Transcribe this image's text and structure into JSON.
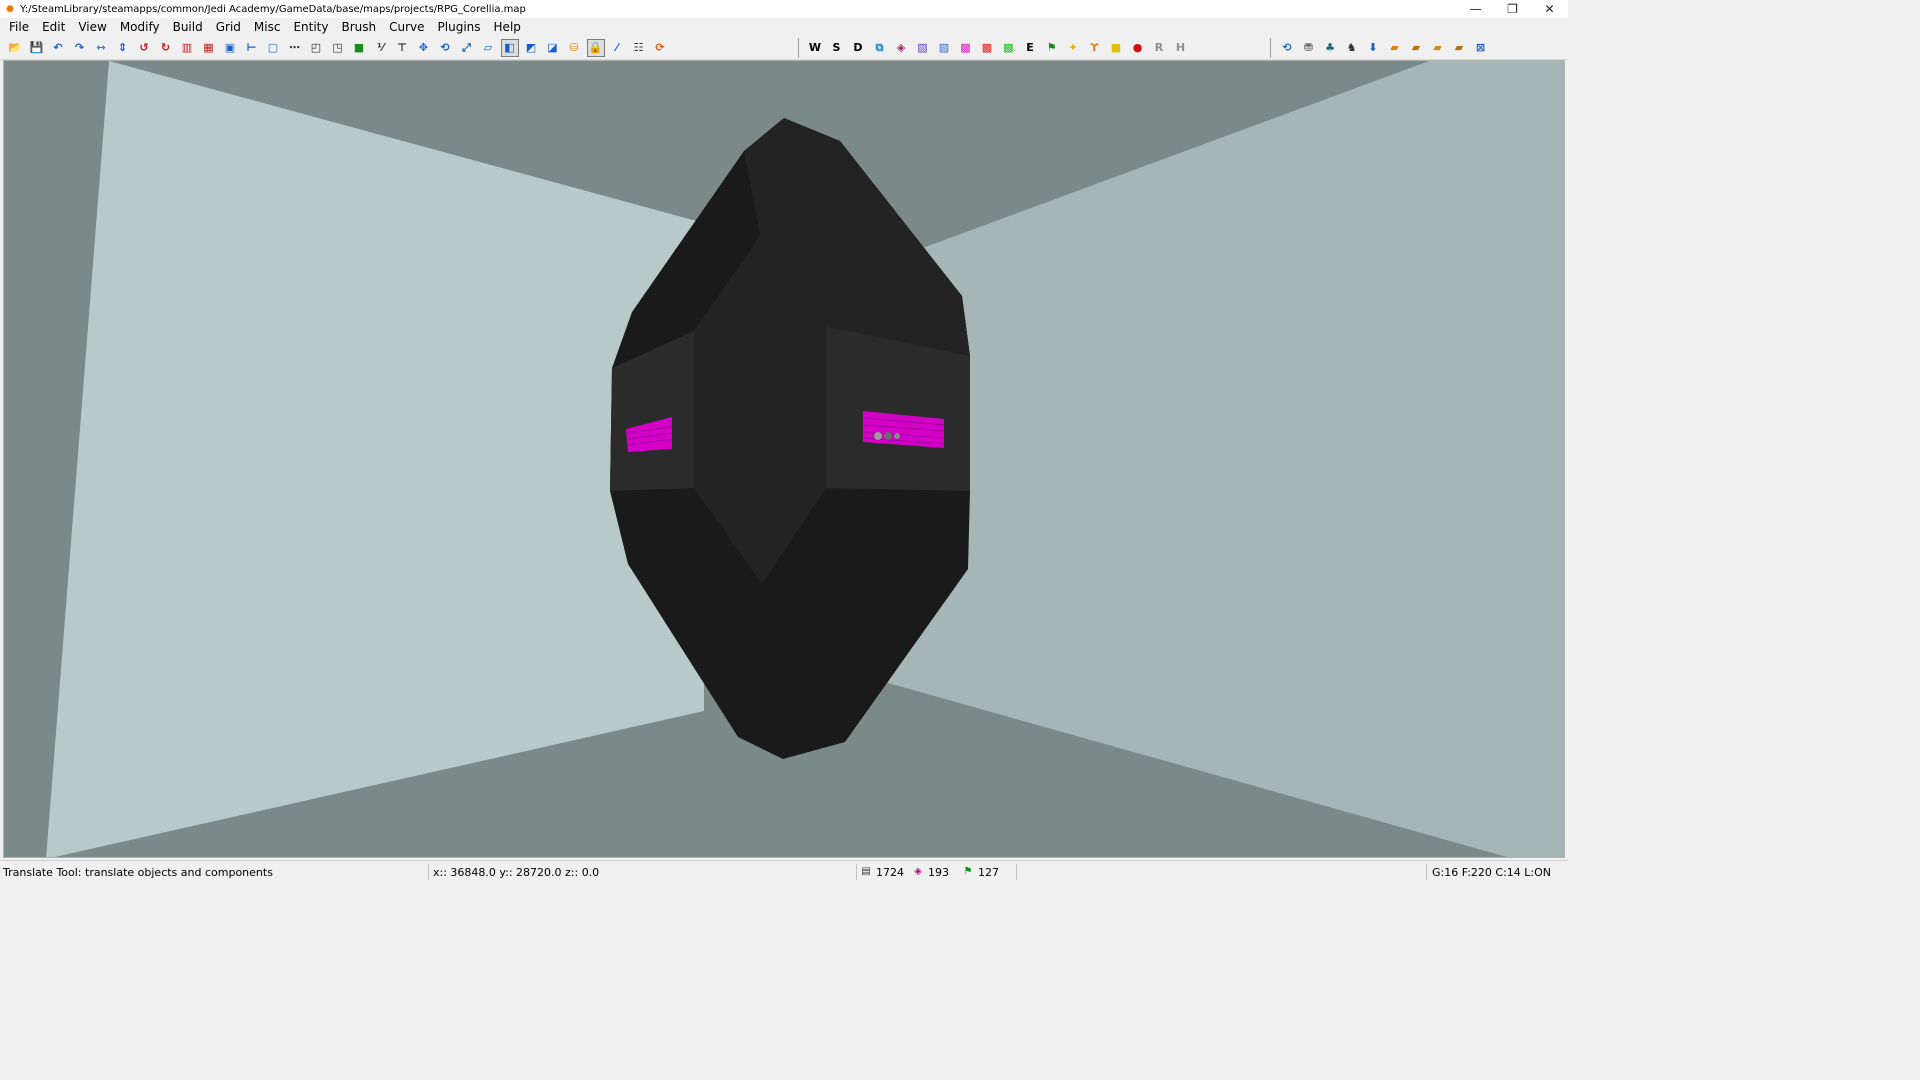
{
  "window": {
    "title": "Y:/SteamLibrary/steamapps/common/Jedi Academy/GameData/base/maps/projects/RPG_Corellia.map",
    "app_icon": "gtkradiant-logo-icon",
    "controls": [
      "minimize-icon",
      "restore-icon",
      "close-icon"
    ]
  },
  "menu": [
    "File",
    "Edit",
    "View",
    "Modify",
    "Build",
    "Grid",
    "Misc",
    "Entity",
    "Brush",
    "Curve",
    "Plugins",
    "Help"
  ],
  "toolbar": {
    "group1": [
      {
        "name": "open-icon",
        "glyph": "📂",
        "color": "#c88a10"
      },
      {
        "name": "save-icon",
        "glyph": "💾",
        "color": "#333333"
      },
      {
        "name": "undo-icon",
        "glyph": "↶",
        "color": "#1a5fc8"
      },
      {
        "name": "redo-icon",
        "glyph": "↷",
        "color": "#1a5fc8"
      },
      {
        "name": "flip-x-icon",
        "glyph": "⇿",
        "color": "#2050c0"
      },
      {
        "name": "flip-y-icon",
        "glyph": "⇕",
        "color": "#2050c0"
      },
      {
        "name": "rotate-x-icon",
        "glyph": "↺",
        "color": "#d01010"
      },
      {
        "name": "rotate-y-icon",
        "glyph": "↻",
        "color": "#d01010"
      },
      {
        "name": "csg-subtract-icon",
        "glyph": "▥",
        "color": "#c02020"
      },
      {
        "name": "csg-merge-icon",
        "glyph": "▦",
        "color": "#c02020"
      },
      {
        "name": "hollow-icon",
        "glyph": "▣",
        "color": "#1a5fc8"
      },
      {
        "name": "clipper-icon",
        "glyph": "⊢",
        "color": "#1a5fc8"
      },
      {
        "name": "select-box-icon",
        "glyph": "▢",
        "color": "#1a5fc8"
      },
      {
        "name": "more-icon",
        "glyph": "⋯",
        "color": "#333333"
      },
      {
        "name": "change-views-icon",
        "glyph": "◰",
        "color": "#333333"
      },
      {
        "name": "texture-view-icon",
        "glyph": "◳",
        "color": "#333333"
      },
      {
        "name": "cube-clip-icon",
        "glyph": "■",
        "color": "#1a8a1a"
      },
      {
        "name": "camera-change-icon",
        "glyph": "⅟",
        "color": "#333333"
      },
      {
        "name": "patch-icon",
        "glyph": "⊤",
        "color": "#333333"
      },
      {
        "name": "translate-icon",
        "glyph": "✥",
        "color": "#1a5fc8"
      },
      {
        "name": "rotate-icon",
        "glyph": "⟲",
        "color": "#1a5fc8"
      },
      {
        "name": "scale-icon",
        "glyph": "⤢",
        "color": "#1a5fc8"
      },
      {
        "name": "skew-icon",
        "glyph": "▱",
        "color": "#1a5fc8"
      },
      {
        "name": "drag-icon",
        "glyph": "◧",
        "color": "#1a5fc8",
        "pressed": true
      },
      {
        "name": "resize-icon",
        "glyph": "◩",
        "color": "#1a5fc8"
      },
      {
        "name": "clip-icon",
        "glyph": "◪",
        "color": "#1a5fc8"
      },
      {
        "name": "cylinder-icon",
        "glyph": "⛁",
        "color": "#d08a10"
      },
      {
        "name": "texture-lock-icon",
        "glyph": "🔒",
        "color": "#555555",
        "pressed": true
      },
      {
        "name": "bend-icon",
        "glyph": "⁄",
        "color": "#1a5fc8"
      },
      {
        "name": "entity-list-icon",
        "glyph": "☷",
        "color": "#333333"
      },
      {
        "name": "refresh-icon",
        "glyph": "⟳",
        "color": "#e06010"
      }
    ],
    "group2": [
      {
        "name": "filter-world-icon",
        "glyph": "W",
        "color": "#000000"
      },
      {
        "name": "filter-structural-icon",
        "glyph": "S",
        "color": "#000000"
      },
      {
        "name": "filter-detail-icon",
        "glyph": "D",
        "color": "#000000"
      },
      {
        "name": "filter-areaportal-icon",
        "glyph": "⧉",
        "color": "#1a8ad0"
      },
      {
        "name": "filter-caulk-icon",
        "glyph": "◈",
        "color": "#a02060"
      },
      {
        "name": "filter-clip-icon",
        "glyph": "▧",
        "color": "#6040c0"
      },
      {
        "name": "filter-hint-icon",
        "glyph": "▨",
        "color": "#4060c0"
      },
      {
        "name": "filter-translucent-icon",
        "glyph": "▩",
        "color": "#e020c0"
      },
      {
        "name": "filter-liquids-icon",
        "glyph": "▩",
        "color": "#e02020"
      },
      {
        "name": "filter-triggers-icon",
        "glyph": "▩",
        "color": "#20c020"
      },
      {
        "name": "filter-entities-icon",
        "glyph": "E",
        "color": "#000000"
      },
      {
        "name": "filter-paths-icon",
        "glyph": "⚑",
        "color": "#1a8a1a"
      },
      {
        "name": "filter-lights-icon",
        "glyph": "✦",
        "color": "#e0b010"
      },
      {
        "name": "filter-misc-model-icon",
        "glyph": "ϒ",
        "color": "#e08010"
      },
      {
        "name": "filter-botclip-icon",
        "glyph": "■",
        "color": "#e0c010"
      },
      {
        "name": "filter-fog-icon",
        "glyph": "●",
        "color": "#d01010"
      },
      {
        "name": "filter-r-icon",
        "glyph": "R",
        "color": "#909090"
      },
      {
        "name": "filter-h-icon",
        "glyph": "H",
        "color": "#909090"
      }
    ],
    "group3": [
      {
        "name": "build-cycle-icon",
        "glyph": "⟲",
        "color": "#1a70c0"
      },
      {
        "name": "brush-model-icon",
        "glyph": "⛃",
        "color": "#555555"
      },
      {
        "name": "bsp-tree-icon",
        "glyph": "♣",
        "color": "#1a6a6a"
      },
      {
        "name": "bsp-entities-icon",
        "glyph": "♞",
        "color": "#333333"
      },
      {
        "name": "bsp-down-icon",
        "glyph": "⬇",
        "color": "#1a5fc8"
      },
      {
        "name": "shader-1-icon",
        "glyph": "▰",
        "color": "#e08010"
      },
      {
        "name": "shader-2-icon",
        "glyph": "▰",
        "color": "#c07010"
      },
      {
        "name": "shader-3-icon",
        "glyph": "▰",
        "color": "#d08a10"
      },
      {
        "name": "shader-4-icon",
        "glyph": "▰",
        "color": "#b07010"
      },
      {
        "name": "close-view-icon",
        "glyph": "⊠",
        "color": "#1a5fc8"
      }
    ]
  },
  "viewport": {
    "colors": {
      "wall_light": "#b7c9c8",
      "wall_right": "#a6b5b5",
      "floor_ceiling": "#7b8988",
      "object_dark": "#1a1a1a",
      "object_mid": "#232323",
      "object_band": "#2b2b2b",
      "texture_magenta": "#d400c8"
    }
  },
  "status": {
    "tool_hint": "Translate Tool: translate objects and components",
    "coords": "x:: 36848.0  y:: 28720.0  z::   0.0",
    "brush_count": "1724",
    "patch_count": "193",
    "entity_count": "127",
    "grid_info": "G:16  F:220  C:14  L:ON"
  }
}
